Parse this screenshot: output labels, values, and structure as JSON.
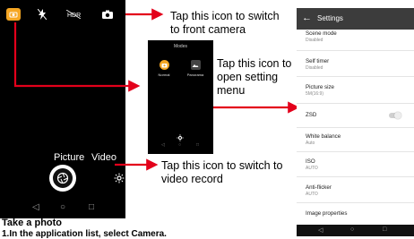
{
  "phone": {
    "modes": {
      "picture": "Picture",
      "video": "Video"
    }
  },
  "callouts": {
    "switch_camera": "Tap this icon to switch to front camera",
    "open_settings": "Tap this icon to open setting menu",
    "video_record": "Tap this icon to switch to video record"
  },
  "modes_popup": {
    "title": "Modes",
    "items": [
      {
        "label": "Normal",
        "icon": "camera-mode-icon"
      },
      {
        "label": "Panorama",
        "icon": "panorama-icon"
      }
    ]
  },
  "settings": {
    "title": "Settings",
    "items": [
      {
        "name": "Scene mode",
        "value": "Disabled"
      },
      {
        "name": "Self timer",
        "value": "Disabled"
      },
      {
        "name": "Picture size",
        "value": "5M(16:9)"
      },
      {
        "name": "ZSD",
        "value": ""
      },
      {
        "name": "White balance",
        "value": "Auto"
      },
      {
        "name": "ISO",
        "value": "AUTO"
      },
      {
        "name": "Anti-flicker",
        "value": "AUTO"
      },
      {
        "name": "Image properties",
        "value": ""
      }
    ]
  },
  "footer": {
    "heading": "Take a photo",
    "step": "1.In the application list, select Camera."
  },
  "colors": {
    "accent_orange": "#f5a623",
    "arrow_red": "#e3001b"
  }
}
